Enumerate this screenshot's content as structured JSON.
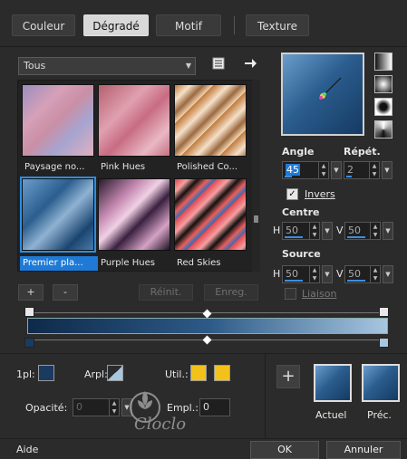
{
  "tabs": [
    {
      "label": "Couleur"
    },
    {
      "label": "Dégradé"
    },
    {
      "label": "Motif"
    },
    {
      "label": "Texture"
    }
  ],
  "category_dropdown": {
    "value": "Tous"
  },
  "gallery": {
    "items": [
      {
        "label": "Paysage no...",
        "selected": false
      },
      {
        "label": "Pink Hues",
        "selected": false
      },
      {
        "label": "Polished Co...",
        "selected": false
      },
      {
        "label": "Premier pla...",
        "selected": true
      },
      {
        "label": "Purple Hues",
        "selected": false
      },
      {
        "label": "Red Skies",
        "selected": false
      }
    ]
  },
  "gallery_buttons": {
    "add": "+",
    "remove": "-",
    "reset": "Réinit.",
    "save": "Enreg."
  },
  "angle": {
    "label": "Angle",
    "value": "45"
  },
  "repeat": {
    "label": "Répét.",
    "value": "2"
  },
  "invert": {
    "label": "Invers",
    "checked": true
  },
  "center": {
    "label": "Centre",
    "h_label": "H",
    "h_value": "50",
    "v_label": "V",
    "v_value": "50"
  },
  "source": {
    "label": "Source",
    "h_label": "H",
    "h_value": "50",
    "v_label": "V",
    "v_value": "50"
  },
  "link": {
    "label": "Liaison",
    "checked": false
  },
  "stops_panel": {
    "opacity_label": "1pl:",
    "arpl_label": "Arpl:",
    "util_label": "Util.:",
    "opacity_field_label": "Opacité:",
    "opacity_value": "0",
    "empl_label": "Empl.:",
    "empl_value": "0"
  },
  "results": {
    "add_label": "+",
    "current_label": "Actuel",
    "previous_label": "Préc."
  },
  "footer": {
    "help": "Aide",
    "ok": "OK",
    "cancel": "Annuler"
  },
  "watermark": {
    "text": "Cloclo"
  },
  "colors": {
    "accent": "#1e7ad6",
    "gradient_dark": "#0e2a4a",
    "gradient_mid": "#2c5a86",
    "gradient_light": "#a7c6e0",
    "util_swatch": "#f2c21b"
  }
}
